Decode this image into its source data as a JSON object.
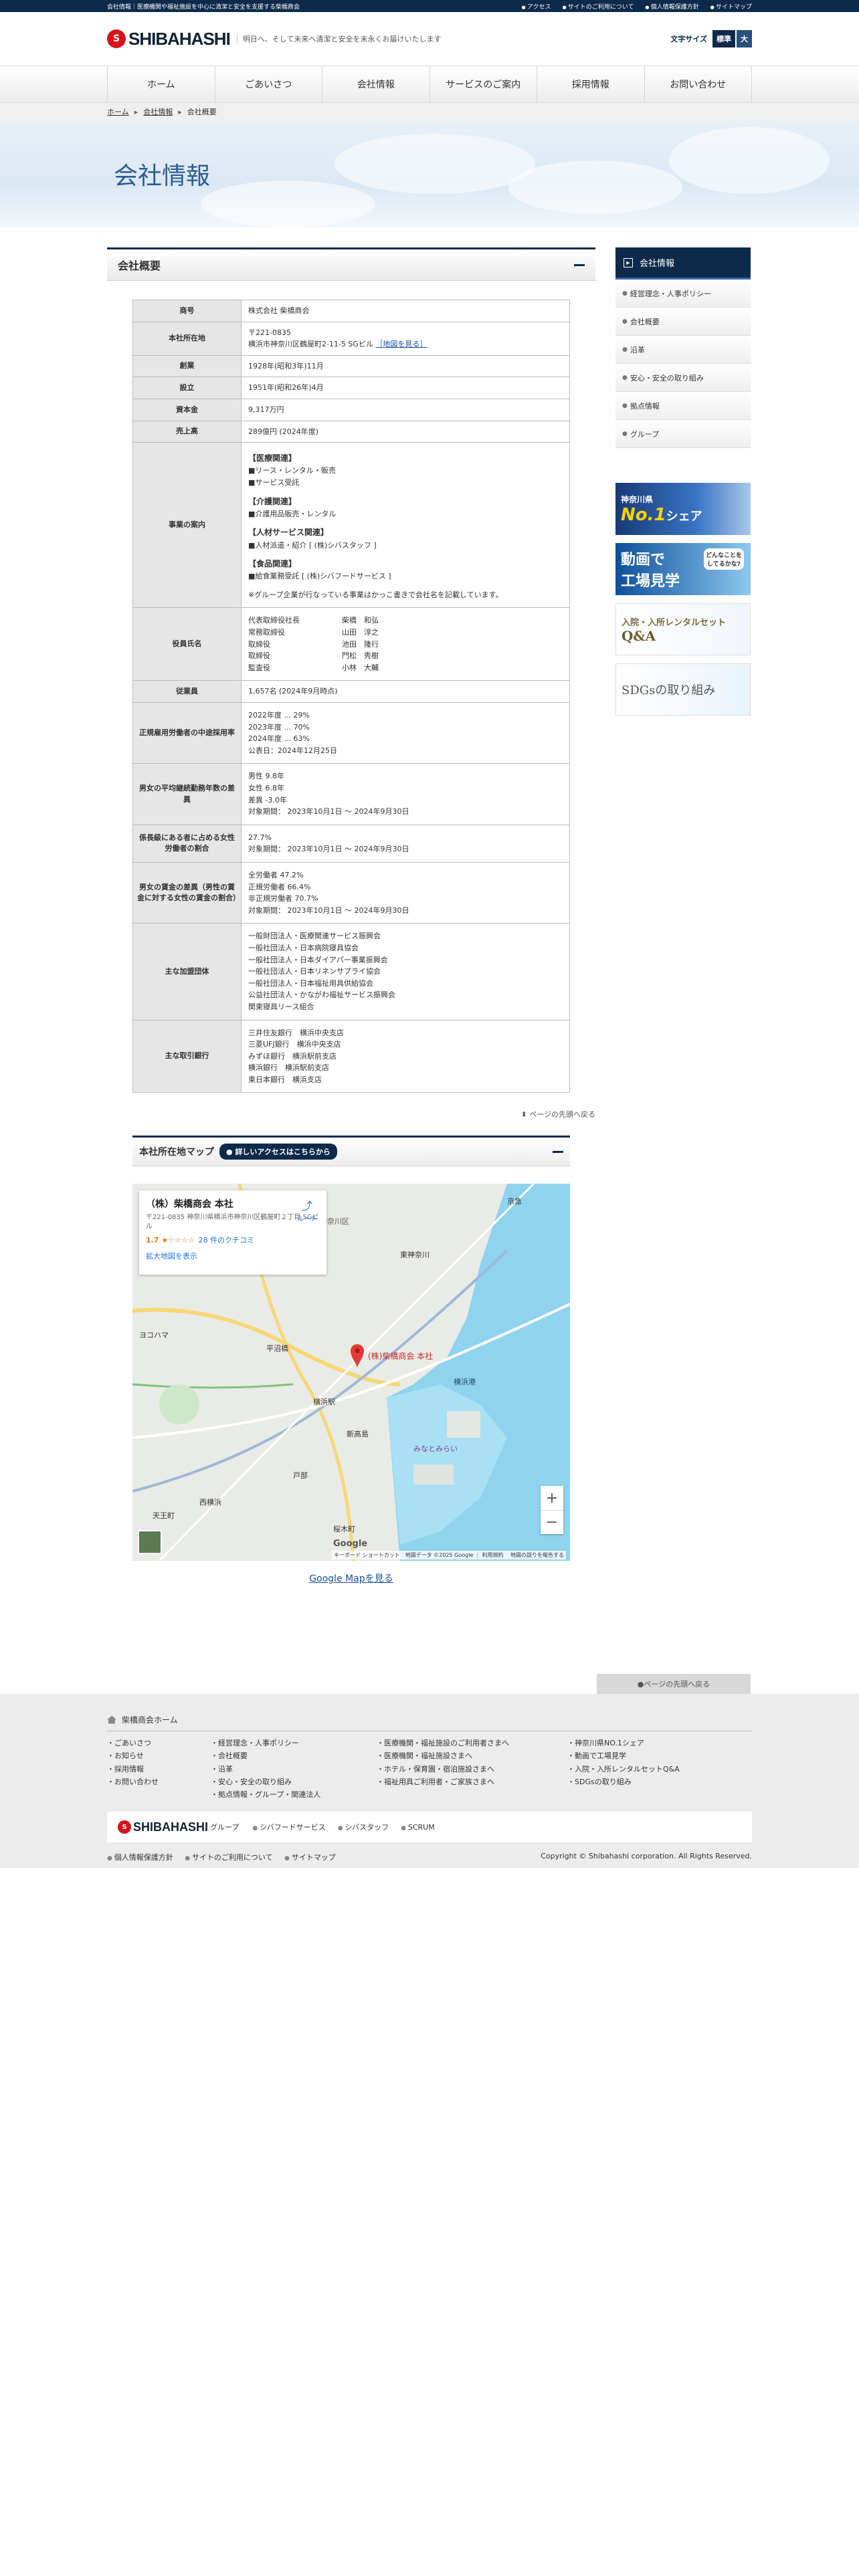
{
  "topbar": {
    "lead": "会社情報｜医療機関や福祉施設を中心に清潔と安全を支援する柴橋商会",
    "links": [
      "アクセス",
      "サイトのご利用について",
      "個人情報保護方針",
      "サイトマップ"
    ]
  },
  "header": {
    "logo": "SHIBAHASHI",
    "tagline": "明日へ、そして未来へ清潔と安全を末永くお届けいたします",
    "fontsize_label": "文字サイズ",
    "fontsize_std": "標準",
    "fontsize_large": "大"
  },
  "nav": [
    "ホーム",
    "ごあいさつ",
    "会社情報",
    "サービスのご案内",
    "採用情報",
    "お問い合わせ"
  ],
  "breadcrumb": [
    "ホーム",
    "会社情報",
    "会社概要"
  ],
  "hero_title": "会社情報",
  "section_title": "会社概要",
  "table": {
    "r1": {
      "h": "商号",
      "v": "株式会社 柴橋商会"
    },
    "r2": {
      "h": "本社所在地",
      "v1": "〒221-0835",
      "v2": "横浜市神奈川区鶴屋町2-11-5 SGビル",
      "link": "［地図を見る］"
    },
    "r3": {
      "h": "創業",
      "v": "1928年(昭和3年)11月"
    },
    "r4": {
      "h": "設立",
      "v": "1951年(昭和26年)4月"
    },
    "r5": {
      "h": "資本金",
      "v": "9,317万円"
    },
    "r6": {
      "h": "売上高",
      "v": "289億円 (2024年度)"
    },
    "r7": {
      "h": "事業の案内",
      "b1h": "【医療関連】",
      "b1a": "■リース・レンタル・販売",
      "b1b": "■サービス受託",
      "b2h": "【介護関連】",
      "b2a": "■介護用品販売・レンタル",
      "b3h": "【人材サービス関連】",
      "b3a": "■人材派遣・紹介 [ (株)シバスタッフ ]",
      "b4h": "【食品関連】",
      "b4a": "■給食業務受託 [ (株)シバフードサービス ]",
      "note": "※グループ企業が行なっている事業はかっこ書きで会社名を記載しています。"
    },
    "r8": {
      "h": "役員氏名",
      "titles": [
        "代表取締役社長",
        "常務取締役",
        "取締役",
        "取締役",
        "監査役"
      ],
      "names": [
        "柴橋　和弘",
        "山田　淳之",
        "池田　隆行",
        "門松　秀樹",
        "小林　大輔"
      ]
    },
    "r9": {
      "h": "従業員",
      "v": "1,657名 (2024年9月時点)"
    },
    "r10": {
      "h": "正規雇用労働者の中途採用率",
      "l1": "2022年度 ... 29%",
      "l2": "2023年度 ... 70%",
      "l3": "2024年度 ... 63%",
      "l4": "公表日：2024年12月25日"
    },
    "r11": {
      "h": "男女の平均継続勤務年数の差異",
      "l1": "男性 9.8年",
      "l2": "女性 6.8年",
      "l3": "差異 -3.0年",
      "l4": "対象期間： 2023年10月1日 〜 2024年9月30日"
    },
    "r12": {
      "h": "係長級にある者に占める女性労働者の割合",
      "l1": "27.7%",
      "l2": "対象期間： 2023年10月1日 〜 2024年9月30日"
    },
    "r13": {
      "h": "男女の賃金の差異（男性の賃金に対する女性の賃金の割合）",
      "l1": "全労働者 47.2%",
      "l2": "正規労働者 66.4%",
      "l3": "非正規労働者 70.7%",
      "l4": "対象期間： 2023年10月1日 〜 2024年9月30日"
    },
    "r14": {
      "h": "主な加盟団体",
      "items": [
        "一般財団法人・医療関連サービス振興会",
        "一般社団法人・日本病院寝具協会",
        "一般社団法人・日本ダイアパー事業振興会",
        "一般社団法人・日本リネンサプライ協会",
        "一般社団法人・日本福祉用具供給協会",
        "公益社団法人・かながわ福祉サービス振興会",
        "関東寝具リース組合"
      ]
    },
    "r15": {
      "h": "主な取引銀行",
      "items": [
        "三井住友銀行　横浜中央支店",
        "三菱UFJ銀行　横浜中央支店",
        "みずほ銀行　横浜駅前支店",
        "横浜銀行　横浜駅前支店",
        "東日本銀行　横浜支店"
      ]
    }
  },
  "to_top": "ページの先頭へ戻る",
  "map": {
    "title": "本社所在地マップ",
    "access_btn": "詳しいアクセスはこちらから",
    "card_title": "（株）柴橋商会 本社",
    "card_addr": "〒221-0835 神奈川県横浜市神奈川区鶴屋町２丁目 SGビル",
    "rating": "1.7 ★☆☆☆☆",
    "reviews": "28 件のクチコミ",
    "enlarge": "拡大地図を表示",
    "route": "ルート",
    "pin_label": "(株)柴橋商会 本社",
    "footer_note": "キーボード ショートカット　地図データ ©2025 Google ｜ 利用規約 　地図の誤りを報告する",
    "google": "Google",
    "labels": [
      "神奈川区",
      "横浜駅",
      "新高島",
      "みなとみらい",
      "横浜港",
      "平沼橋",
      "天王町",
      "西横浜",
      "戸部",
      "桜木町",
      "ヨコハマ",
      "東神奈川",
      "京急"
    ],
    "link": "Google Mapを見る"
  },
  "side": {
    "head": "会社情報",
    "items": [
      "経営理念・人事ポリシー",
      "会社概要",
      "沿革",
      "安心・安全の取り組み",
      "拠点情報",
      "グループ"
    ],
    "b1a": "神奈川県",
    "b1b": "No.1",
    "b1c": "シェア",
    "b2a": "動画で",
    "b2b": "工場見学",
    "b2s": "どんなことを\nしてるかな?",
    "b3a": "入院・入所レンタルセット",
    "b3b": "Q&A",
    "b4": "SDGsの取り組み"
  },
  "footer": {
    "home": "柴橋商会ホーム",
    "col1": [
      "ごあいさつ",
      "お知らせ",
      "採用情報",
      "お問い合わせ"
    ],
    "col2": [
      "経営理念・人事ポリシー",
      "会社概要",
      "沿革",
      "安心・安全の取り組み",
      "拠点情報・グループ・関連法人"
    ],
    "col3": [
      "医療機関・福祉施設のご利用者さまへ",
      "医療機関・福祉施設さまへ",
      "ホテル・保育園・宿泊施設さまへ",
      "福祉用具ご利用者・ご家族さまへ"
    ],
    "col4": [
      "神奈川県NO.1シェア",
      "動画で工場見学",
      "入院・入所レンタルセットQ&A",
      "SDGsの取り組み"
    ],
    "group_logo": "SHIBAHASHI",
    "group_word": "グループ",
    "group": [
      "シバフードサービス",
      "シバスタッフ",
      "SCRUM"
    ],
    "bottom": [
      "個人情報保護方針",
      "サイトのご利用について",
      "サイトマップ"
    ],
    "copyright": "Copyright © Shibahashi corporation. All Rights Reserved."
  },
  "colors": {
    "navy": "#0d2a4b",
    "brand_red": "#d7121b"
  }
}
